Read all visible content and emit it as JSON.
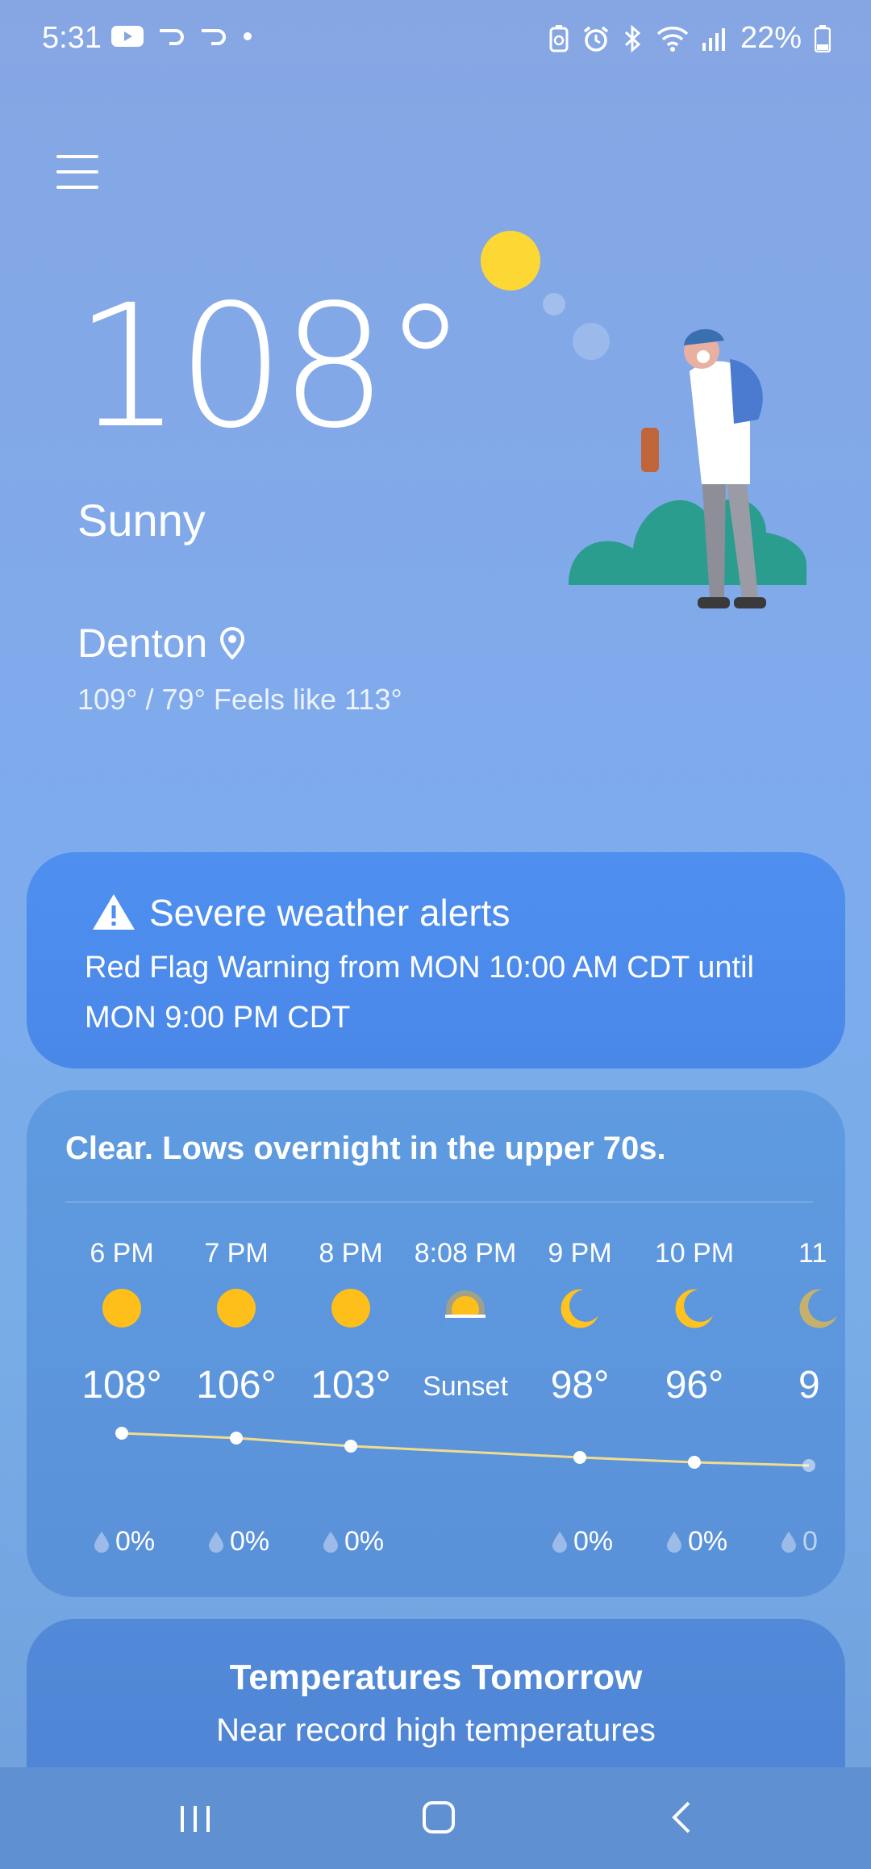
{
  "status_bar": {
    "time": "5:31",
    "battery_percent": "22%",
    "left_icons": [
      "youtube-icon",
      "swipe-icon",
      "swipe-icon",
      "dot-icon"
    ],
    "right_icons": [
      "battery-saver-icon",
      "alarm-icon",
      "bluetooth-icon",
      "wifi-icon",
      "signal-icon",
      "battery-icon"
    ]
  },
  "current": {
    "temperature": "108°",
    "condition": "Sunny",
    "location": "Denton",
    "hilo_feels": "109° / 79° Feels like 113°"
  },
  "alert": {
    "title": "Severe weather alerts",
    "text": "Red Flag Warning from MON 10:00 AM CDT until MON 9:00 PM CDT"
  },
  "forecast": {
    "summary": "Clear. Lows overnight in the upper 70s.",
    "hours": [
      {
        "time": "6 PM",
        "icon": "sun-icon",
        "temp": "108°",
        "precip": "0%"
      },
      {
        "time": "7 PM",
        "icon": "sun-icon",
        "temp": "106°",
        "precip": "0%"
      },
      {
        "time": "8 PM",
        "icon": "sun-icon",
        "temp": "103°",
        "precip": "0%"
      },
      {
        "time": "8:08 PM",
        "icon": "sunset-icon",
        "temp": "Sunset",
        "precip": ""
      },
      {
        "time": "9 PM",
        "icon": "moon-icon",
        "temp": "98°",
        "precip": "0%"
      },
      {
        "time": "10 PM",
        "icon": "moon-icon",
        "temp": "96°",
        "precip": "0%"
      },
      {
        "time": "11",
        "icon": "moon-icon",
        "temp": "9",
        "precip": "0"
      }
    ]
  },
  "tomorrow": {
    "title": "Temperatures Tomorrow",
    "subtitle": "Near record high temperatures"
  },
  "colors": {
    "sun": "#ffbf1a",
    "moon": "#ffc21e",
    "alert_card": "#4e8ff0",
    "graph_line": "#f0dc90"
  }
}
